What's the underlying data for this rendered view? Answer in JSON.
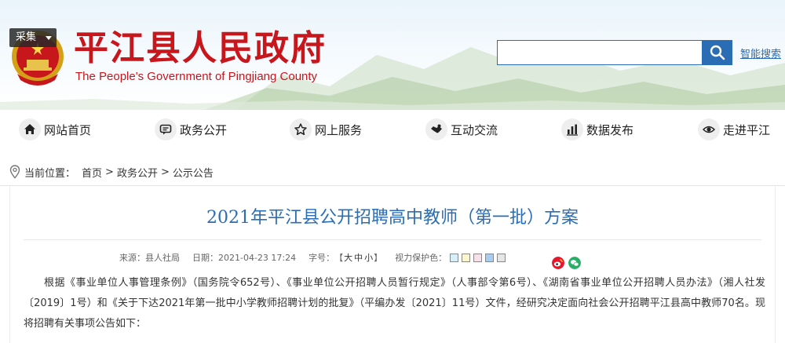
{
  "header": {
    "collect_label": "采集",
    "site_title": "平江县人民政府",
    "site_subtitle": "The People's Government of Pingjiang County",
    "search_placeholder": "",
    "smart_search": "智能搜索"
  },
  "nav": [
    {
      "label": "网站首页",
      "icon": "home-icon"
    },
    {
      "label": "政务公开",
      "icon": "chat-icon"
    },
    {
      "label": "网上服务",
      "icon": "star-icon"
    },
    {
      "label": "互动交流",
      "icon": "handshake-icon"
    },
    {
      "label": "数据发布",
      "icon": "bar-chart-icon"
    },
    {
      "label": "走进平江",
      "icon": "eye-icon"
    }
  ],
  "breadcrumb": {
    "prefix": "当前位置：",
    "items": [
      "首页",
      "政务公开",
      "公示公告"
    ],
    "sep": ">"
  },
  "article": {
    "title": "2021年平江县公开招聘高中教师（第一批）方案",
    "meta": {
      "source": "来源：县人社局",
      "date": "日期：2021-04-23 17:24",
      "font_size_label": "字号：",
      "font_size_open": "【",
      "font_sizes": [
        "大",
        "中",
        "小"
      ],
      "font_size_close": "】",
      "vision_label": "视力保护色："
    },
    "vision_colors": [
      "#d8eef8",
      "#fbf6cc",
      "#f6e1e8",
      "#a9cdf0",
      "#e6e6e6"
    ],
    "body": "根据《事业单位人事管理条例》（国务院令652号）、《事业单位公开招聘人员暂行规定》（人事部令第6号）、《湖南省事业单位公开招聘人员办法》（湘人社发〔2019〕1号）和《关于下达2021年第一批中小学教师招聘计划的批复》（平编办发〔2021〕11号）文件，经研究决定面向社会公开招聘平江县高中教师70名。现将招聘有关事项公告如下："
  },
  "colors": {
    "brand_red": "#c8161d",
    "accent_blue": "#2b6db5"
  }
}
